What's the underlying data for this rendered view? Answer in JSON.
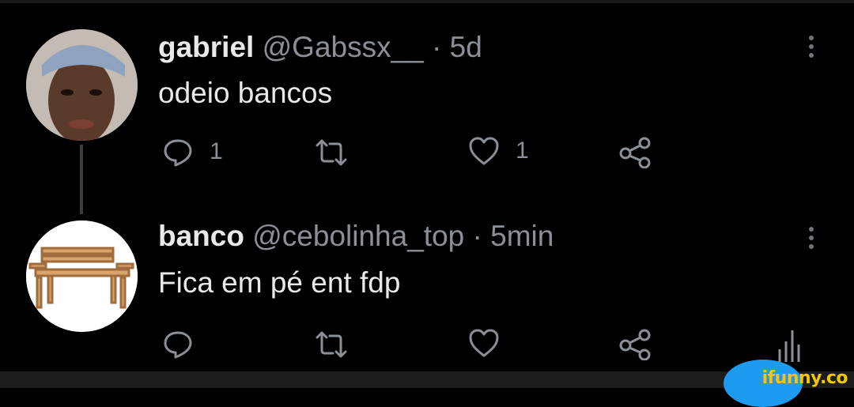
{
  "tweets": [
    {
      "name": "gabriel",
      "handle": "@Gabssx__",
      "separator": "·",
      "time": "5d",
      "text": "odeio bancos",
      "reply_count": "1",
      "retweet_count": "",
      "like_count": "1"
    },
    {
      "name": "banco",
      "handle": "@cebolinha_top",
      "separator": "·",
      "time": "5min",
      "text": "Fica em pé ent fdp",
      "reply_count": "",
      "retweet_count": "",
      "like_count": ""
    }
  ],
  "watermark": "ifunny.co",
  "icons": [
    "reply-icon",
    "retweet-icon",
    "like-icon",
    "share-icon",
    "more-options-icon",
    "analytics-icon"
  ],
  "colors": {
    "background": "#000000",
    "text": "#e7e9ea",
    "secondary": "#8b9096",
    "accent": "#1d9bf0"
  }
}
